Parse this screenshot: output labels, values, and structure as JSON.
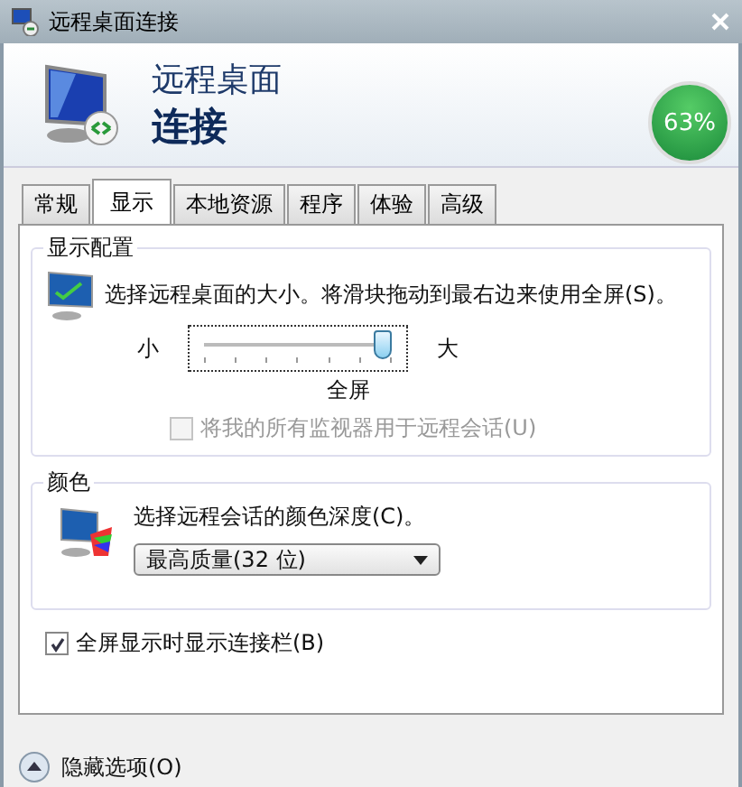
{
  "window": {
    "title": "远程桌面连接"
  },
  "banner": {
    "line_1": "远程桌面",
    "line_2": "连接"
  },
  "percent_badge": "63%",
  "tabs": [
    {
      "label": "常规",
      "selected": false
    },
    {
      "label": "显示",
      "selected": true
    },
    {
      "label": "本地资源",
      "selected": false
    },
    {
      "label": "程序",
      "selected": false
    },
    {
      "label": "体验",
      "selected": false
    },
    {
      "label": "高级",
      "selected": false
    }
  ],
  "display_group": {
    "title": "显示配置",
    "description": "选择远程桌面的大小。将滑块拖动到最右边来使用全屏(S)。",
    "min_label": "小",
    "max_label": "大",
    "level": 1,
    "value_label": "全屏",
    "monitors_checkbox": {
      "label": "将我的所有监视器用于远程会话(U)",
      "checked": false,
      "disabled": true
    }
  },
  "color_group": {
    "title": "颜色",
    "description": "选择远程会话的颜色深度(C)。",
    "dropdown_value": "最高质量(32 位)"
  },
  "connection_bar_checkbox": {
    "label": "全屏显示时显示连接栏(B)",
    "checked": true,
    "disabled": false
  },
  "hide_options": "隐藏选项(O)"
}
